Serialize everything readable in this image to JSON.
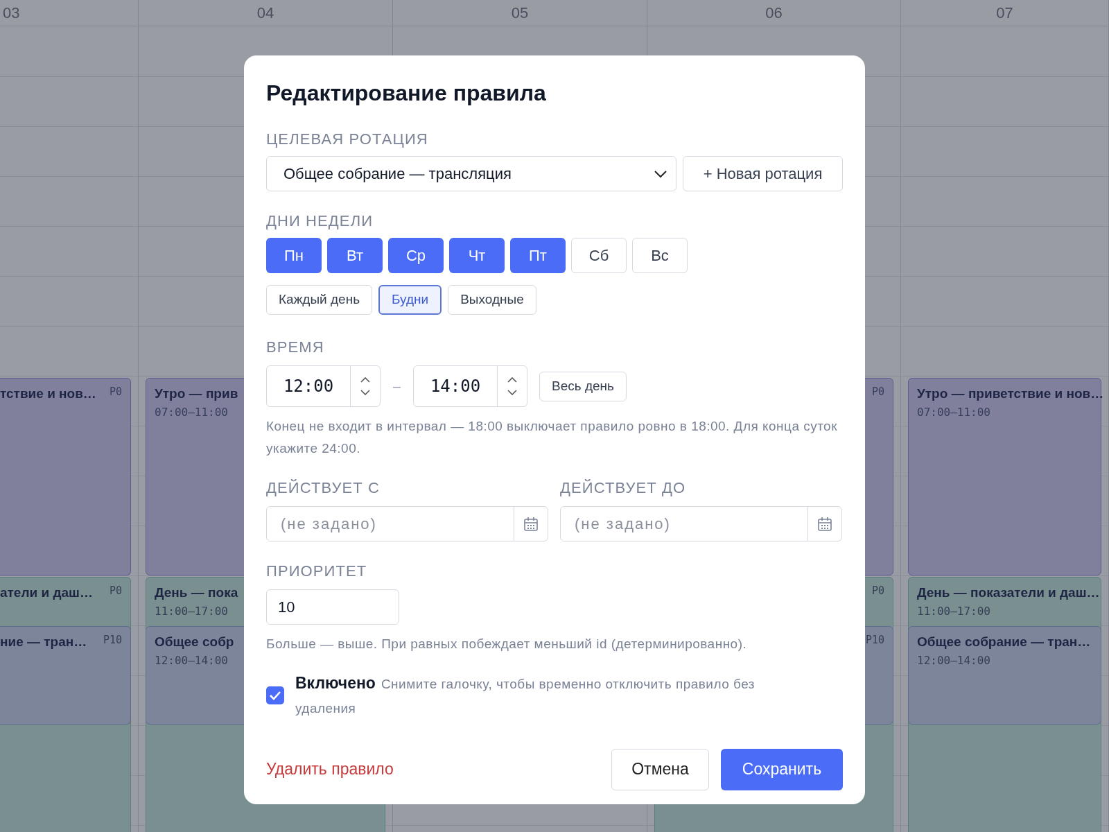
{
  "calendar": {
    "columns": [
      {
        "day": "03",
        "events": [
          {
            "kind": "morning",
            "title": "тствие и нов…",
            "priority": "P0"
          },
          {
            "kind": "day",
            "title": "атели и даш…",
            "priority": "P0"
          },
          {
            "kind": "meeting",
            "title": "ние — тран…",
            "priority": "P10"
          }
        ]
      },
      {
        "day": "04",
        "events": [
          {
            "kind": "morning",
            "title": "Утро — прив",
            "time": "07:00–11:00"
          },
          {
            "kind": "day",
            "title": "День — пока",
            "time": "11:00–17:00"
          },
          {
            "kind": "meeting",
            "title": "Общее собр",
            "time": "12:00–14:00"
          }
        ]
      },
      {
        "day": "05"
      },
      {
        "day": "06",
        "events": [
          {
            "kind": "morning",
            "priority": "P0"
          },
          {
            "kind": "day",
            "priority": "P0"
          },
          {
            "kind": "meeting",
            "priority": "P10"
          }
        ]
      },
      {
        "day": "07",
        "events": [
          {
            "kind": "morning",
            "title": "Утро — приветствие и нов…",
            "time": "07:00–11:00"
          },
          {
            "kind": "day",
            "title": "День — показатели и даш…",
            "time": "11:00–17:00"
          },
          {
            "kind": "meeting",
            "title": "Общее собрание — тран…",
            "time": "12:00–14:00"
          }
        ]
      }
    ]
  },
  "dialog": {
    "title": "Редактирование правила",
    "rotation": {
      "label": "ЦЕЛЕВАЯ РОТАЦИЯ",
      "value": "Общее собрание — трансляция",
      "new_button": "+ Новая ротация"
    },
    "weekdays": {
      "label": "ДНИ НЕДЕЛИ",
      "days": [
        {
          "label": "Пн",
          "selected": true
        },
        {
          "label": "Вт",
          "selected": true
        },
        {
          "label": "Ср",
          "selected": true
        },
        {
          "label": "Чт",
          "selected": true
        },
        {
          "label": "Пт",
          "selected": true
        },
        {
          "label": "Сб",
          "selected": false
        },
        {
          "label": "Вс",
          "selected": false
        }
      ],
      "presets": [
        {
          "label": "Каждый день",
          "selected": false
        },
        {
          "label": "Будни",
          "selected": true
        },
        {
          "label": "Выходные",
          "selected": false
        }
      ]
    },
    "time": {
      "label": "ВРЕМЯ",
      "start": "12:00",
      "separator": "–",
      "end": "14:00",
      "all_day_button": "Весь день",
      "hint": "Конец не входит в интервал — 18:00 выключает правило ровно в 18:00. Для конца суток укажите 24:00."
    },
    "valid_from": {
      "label": "ДЕЙСТВУЕТ С",
      "placeholder": "(не задано)"
    },
    "valid_to": {
      "label": "ДЕЙСТВУЕТ ДО",
      "placeholder": "(не задано)"
    },
    "priority": {
      "label": "ПРИОРИТЕТ",
      "value": "10",
      "hint": "Больше — выше. При равных побеждает меньший id (детерминированно)."
    },
    "enabled": {
      "label": "Включено",
      "description": "Снимите галочку, чтобы временно отключить правило без удаления",
      "checked": true
    },
    "delete_link": "Удалить правило",
    "cancel_button": "Отмена",
    "save_button": "Сохранить"
  }
}
